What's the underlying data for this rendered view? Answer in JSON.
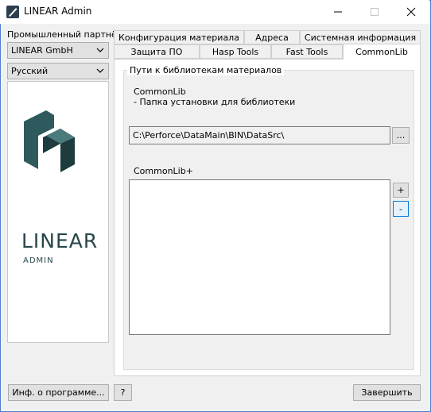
{
  "window": {
    "title": "LINEAR Admin",
    "accent": "#4f81c9"
  },
  "left": {
    "partner_label": "Промышленный партнёр",
    "partner_value": "LINEAR GmbH",
    "language_value": "Русский",
    "logo_text": "LINEAR",
    "logo_sub": "ADMIN",
    "logo_color": "#27474a"
  },
  "tabs": {
    "row1": [
      "Конфигурация материала",
      "Адреса",
      "Системная информация"
    ],
    "row2": [
      "Защита ПО",
      "Hasp Tools",
      "Fast Tools",
      "CommonLib"
    ],
    "active": "CommonLib"
  },
  "commonlib": {
    "group_title": "Пути к библиотекам материалов",
    "label1": "CommonLib",
    "label2": "- Папка установки для библиотеки",
    "path_value": "C:\\Perforce\\DataMain\\BIN\\DataSrc\\",
    "browse_label": "...",
    "plus_list_label": "CommonLib+",
    "add_label": "+",
    "remove_label": "-"
  },
  "footer": {
    "about_label": "Инф. о программе...",
    "help_label": "?",
    "finish_label": "Завершить"
  }
}
